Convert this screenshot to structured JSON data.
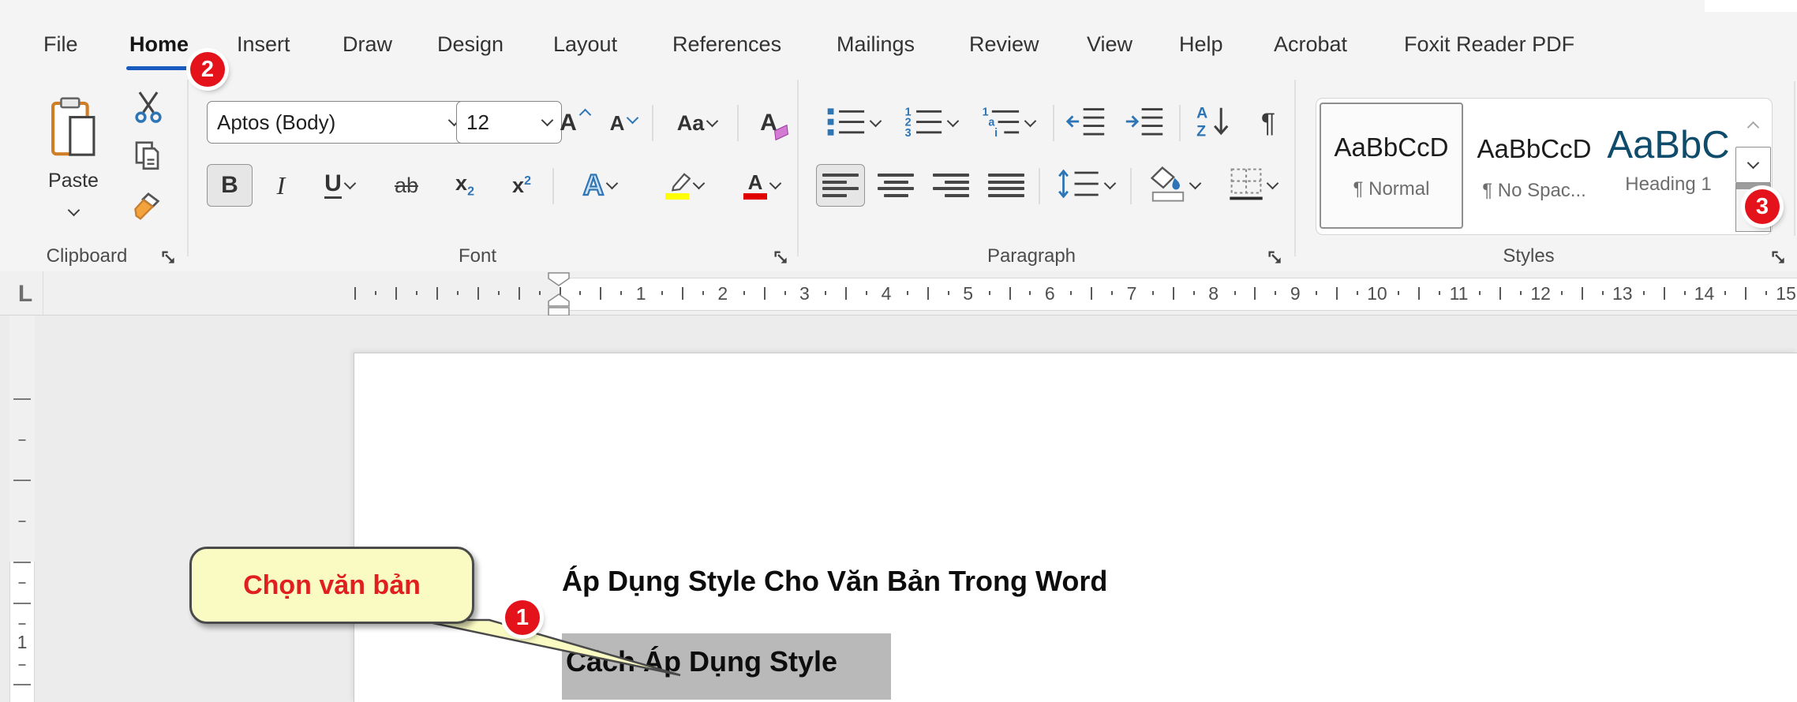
{
  "ribbon": {
    "tabs": [
      {
        "label": "File"
      },
      {
        "label": "Home",
        "active": true
      },
      {
        "label": "Insert"
      },
      {
        "label": "Draw"
      },
      {
        "label": "Design"
      },
      {
        "label": "Layout"
      },
      {
        "label": "References"
      },
      {
        "label": "Mailings"
      },
      {
        "label": "Review"
      },
      {
        "label": "View"
      },
      {
        "label": "Help"
      },
      {
        "label": "Acrobat"
      },
      {
        "label": "Foxit Reader PDF"
      }
    ],
    "clipboard": {
      "group_label": "Clipboard",
      "paste_label": "Paste"
    },
    "font": {
      "group_label": "Font",
      "font_name": "Aptos (Body)",
      "font_size": "12",
      "grow_letter": "A",
      "shrink_letter": "A",
      "change_case": "Aa",
      "clear_letter": "A",
      "bold": "B",
      "italic": "I",
      "underline": "U",
      "strikethrough": "ab",
      "subscript_base": "x",
      "subscript_mark": "2",
      "superscript_base": "x",
      "superscript_mark": "2",
      "effects_letter": "A",
      "font_color_letter": "A"
    },
    "paragraph": {
      "group_label": "Paragraph",
      "num1": "1",
      "num2": "2",
      "num3": "3",
      "ml1": "1",
      "ml2": "a",
      "ml3": "i",
      "sort_a": "A",
      "sort_z": "Z",
      "pilcrow": "¶"
    },
    "styles": {
      "group_label": "Styles",
      "tiles": [
        {
          "sample": "AaBbCcD",
          "label": "¶ Normal",
          "selected": true
        },
        {
          "sample": "AaBbCcD",
          "label": "¶ No Spac..."
        },
        {
          "sample": "AaBbC",
          "label": "Heading 1"
        }
      ]
    }
  },
  "ruler": {
    "tab_selector": "L",
    "horizontal_numbers": [
      "1",
      "2",
      "3",
      "4",
      "5",
      "6",
      "7",
      "8",
      "9",
      "10",
      "11",
      "12",
      "13",
      "14",
      "15"
    ],
    "vertical_numbers": [
      "1"
    ]
  },
  "document": {
    "title": "Áp Dụng Style Cho Văn Bản Trong Word",
    "selected_text": "Cách Áp Dụng Style"
  },
  "callout": {
    "text": "Chọn văn bản"
  },
  "badges": {
    "step1": "1",
    "step2": "2",
    "step3": "3"
  },
  "colors": {
    "accent_blue": "#185abd",
    "badge_red": "#e4131b",
    "callout_fill": "#fafac3",
    "callout_text": "#e02020",
    "selection_gray": "#b9b9b9",
    "heading_style": "#0f4c6b",
    "highlight_yellow": "#ffff00",
    "font_color_red": "#e00000",
    "icon_blue": "#2e75b6"
  }
}
